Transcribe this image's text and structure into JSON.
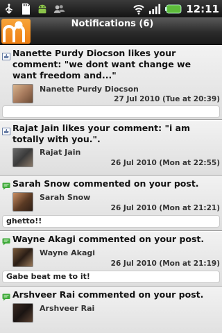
{
  "status_bar": {
    "time": "12:11",
    "icons": [
      "usb-icon",
      "sd-card-icon",
      "android-icon",
      "contacts-icon",
      "wifi-icon",
      "signal-icon",
      "battery-icon"
    ]
  },
  "header": {
    "title": "Notifications (6)",
    "logo": "app-logo-icon"
  },
  "colors": {
    "accent_orange": "#f08a1c",
    "like_icon": "#6a7fa6",
    "comment_icon": "#3faa3a"
  },
  "notifications": [
    {
      "type": "like",
      "icon": "like-icon",
      "headline": "Nanette Purdy Diocson likes your comment: \"we dont want change we want freedom and...\"",
      "actor": "Nanette Purdy Diocson",
      "timestamp": "27 Jul 2010 (Tue at 20:39)",
      "comment": ""
    },
    {
      "type": "like",
      "icon": "like-icon",
      "headline": "Rajat Jain likes your comment: \"i am totally with you.\".",
      "actor": "Rajat Jain",
      "timestamp": "26 Jul 2010 (Mon at 22:55)",
      "comment": ""
    },
    {
      "type": "comment",
      "icon": "comment-icon",
      "headline": "Sarah Snow commented on your post.",
      "actor": "Sarah Snow",
      "timestamp": "26 Jul 2010 (Mon at 21:21)",
      "comment": "ghetto!!"
    },
    {
      "type": "comment",
      "icon": "comment-icon",
      "headline": "Wayne Akagi commented on your post.",
      "actor": "Wayne Akagi",
      "timestamp": "26 Jul 2010 (Mon at 21:19)",
      "comment": "Gabe beat me to it!"
    },
    {
      "type": "comment",
      "icon": "comment-icon",
      "headline": "Arshveer Rai commented on your post.",
      "actor": "Arshveer Rai",
      "timestamp": "",
      "comment": ""
    }
  ]
}
